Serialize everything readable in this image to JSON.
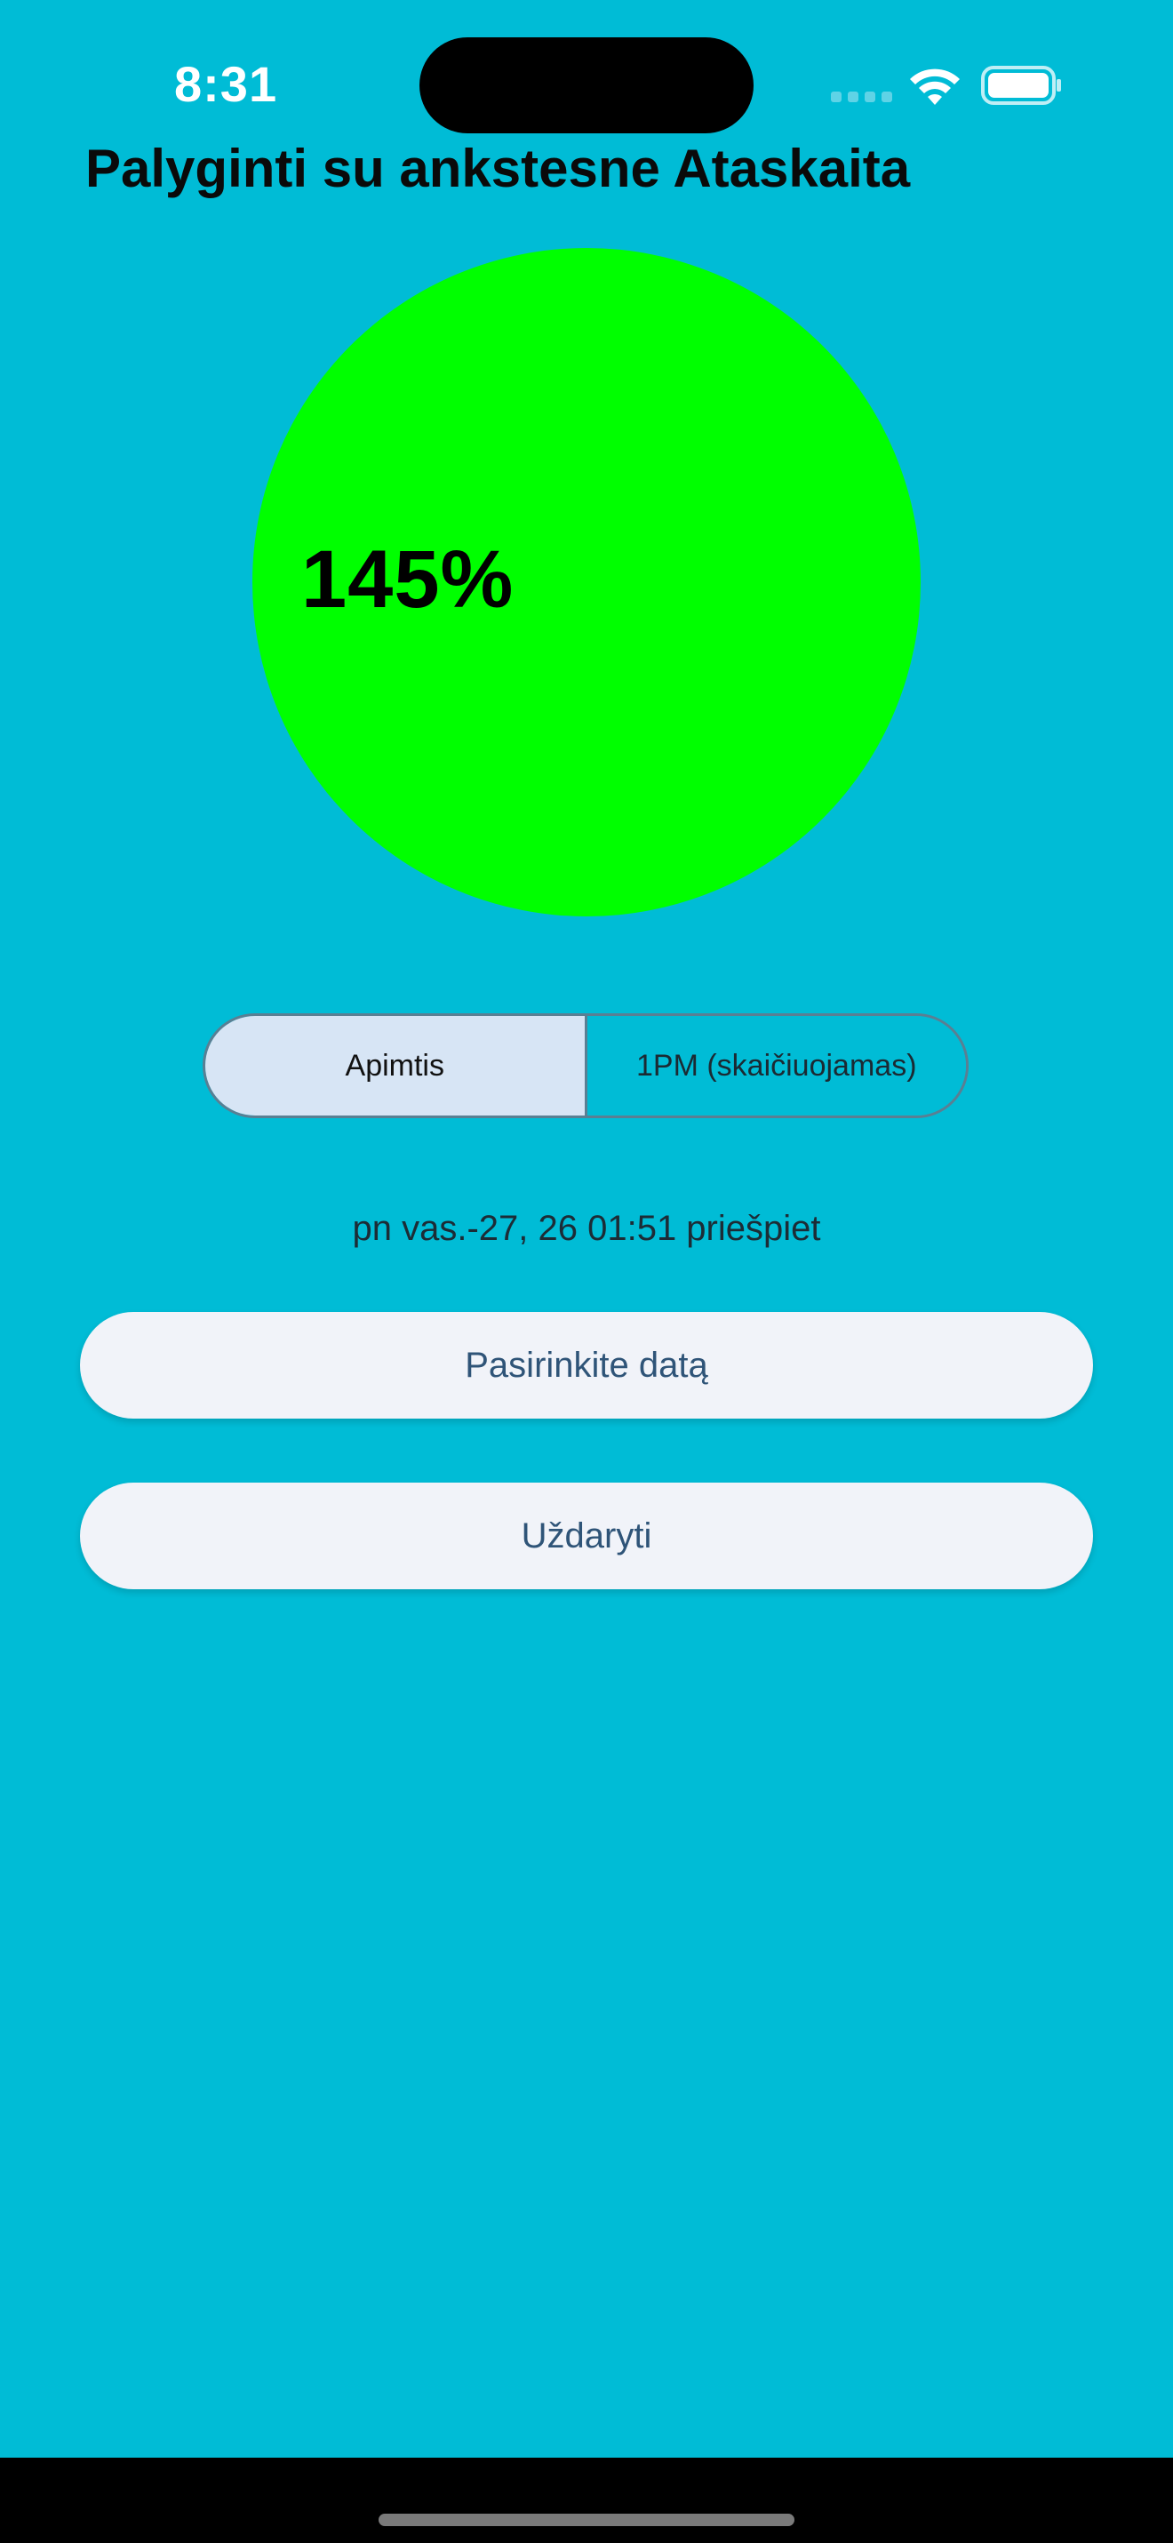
{
  "status_bar": {
    "time": "8:31"
  },
  "header": {
    "title": "Palyginti su ankstesne Ataskaita"
  },
  "gauge": {
    "value_text": "145%",
    "color": "#00FF00"
  },
  "segmented_control": {
    "options": [
      {
        "label": "Apimtis",
        "selected": true
      },
      {
        "label": "1PM (skaičiuojamas)",
        "selected": false
      }
    ]
  },
  "date": {
    "text": "pn vas.-27, 26 01:51 priešpiet"
  },
  "buttons": {
    "select_date_label": "Pasirinkite datą",
    "close_label": "Uždaryti"
  },
  "colors": {
    "background": "#00BCD6",
    "gauge": "#00FF00",
    "segment_selected": "#D7E5F5",
    "button_bg": "#F1F3F9",
    "button_text": "#2f5478"
  },
  "icons": [
    "cellular-signal-icon",
    "wifi-icon",
    "battery-icon"
  ]
}
